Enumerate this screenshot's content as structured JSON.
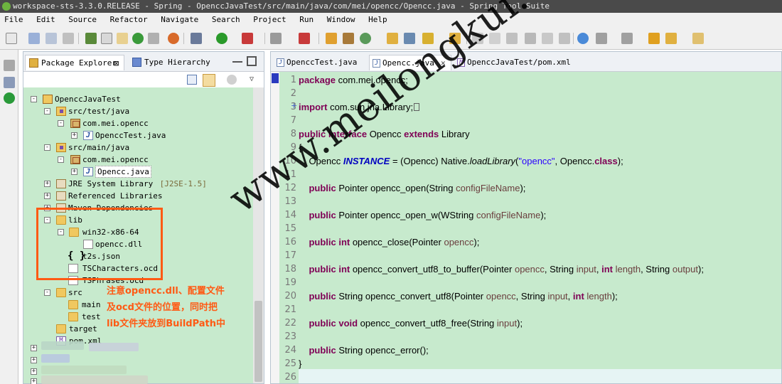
{
  "window": {
    "title": "workspace-sts-3.3.0.RELEASE - Spring - OpenccJavaTest/src/main/java/com/mei/opencc/Opencc.java - Spring Tool Suite"
  },
  "menubar": [
    "File",
    "Edit",
    "Source",
    "Refactor",
    "Navigate",
    "Search",
    "Project",
    "Run",
    "Window",
    "Help"
  ],
  "package_explorer": {
    "tabs": [
      {
        "label": "Package Explorer",
        "close": "⊠",
        "active": true
      },
      {
        "label": "Type Hierarchy",
        "active": false
      }
    ],
    "tree": [
      {
        "label": "OpenccJavaTest",
        "icon": "project-icon",
        "expander": "-"
      },
      {
        "label": "src/test/java",
        "icon": "source-folder-icon",
        "expander": "-"
      },
      {
        "label": "com.mei.opencc",
        "icon": "package-icon",
        "expander": "-"
      },
      {
        "label": "OpenccTest.java",
        "icon": "java-file-icon",
        "expander": "+"
      },
      {
        "label": "src/main/java",
        "icon": "source-folder-icon",
        "expander": "-"
      },
      {
        "label": "com.mei.opencc",
        "icon": "package-icon",
        "expander": "-"
      },
      {
        "label": "Opencc.java",
        "icon": "java-file-icon",
        "expander": "+",
        "selected": true
      },
      {
        "label": "JRE System Library",
        "suffix": "[J2SE-1.5]",
        "icon": "library-icon",
        "expander": "+"
      },
      {
        "label": "Referenced Libraries",
        "icon": "library-icon",
        "expander": "+"
      },
      {
        "label": "Maven Dependencies",
        "icon": "library-icon",
        "expander": "+"
      },
      {
        "label": "lib",
        "icon": "folder-icon",
        "expander": "-"
      },
      {
        "label": "win32-x86-64",
        "icon": "folder-icon",
        "expander": "-"
      },
      {
        "label": "opencc.dll",
        "icon": "file-icon"
      },
      {
        "label": "t2s.json",
        "icon": "json-file-icon"
      },
      {
        "label": "TSCharacters.ocd",
        "icon": "file-icon"
      },
      {
        "label": "TSPhrases.ocd",
        "icon": "file-icon"
      },
      {
        "label": "src",
        "icon": "folder-icon",
        "expander": "-"
      },
      {
        "label": "main",
        "icon": "folder-icon"
      },
      {
        "label": "test",
        "icon": "folder-icon"
      },
      {
        "label": "target",
        "icon": "folder-icon"
      },
      {
        "label": "pom.xml",
        "icon": "xml-file-icon",
        "icon_text": "M"
      }
    ],
    "annotation": [
      "注意opencc.dll、配置文件",
      "及ocd文件的位置，同时把",
      "lib文件夹放到BuildPath中"
    ]
  },
  "editor": {
    "tabs": [
      {
        "label": "OpenccTest.java",
        "active": false
      },
      {
        "label": "Opencc.java",
        "active": true,
        "close": "✕"
      },
      {
        "label": "OpenccJavaTest/pom.xml",
        "active": false
      }
    ],
    "lines": [
      {
        "num": "1",
        "code": [
          [
            "kw",
            "package"
          ],
          [
            "",
            " com.mei.opencc;"
          ]
        ]
      },
      {
        "num": "2",
        "code": []
      },
      {
        "num": "3",
        "fold": "+",
        "code": [
          [
            "kw",
            "import"
          ],
          [
            "",
            " com.sun.jna.Library;"
          ],
          [
            "box",
            ""
          ]
        ]
      },
      {
        "num": "7",
        "code": []
      },
      {
        "num": "8",
        "code": [
          [
            "kw",
            "public interface"
          ],
          [
            "",
            " Opencc "
          ],
          [
            "kw",
            "extends"
          ],
          [
            "",
            " Library"
          ]
        ]
      },
      {
        "num": "9",
        "code": [
          [
            "",
            "{"
          ]
        ]
      },
      {
        "num": "10",
        "code": [
          [
            "",
            "    Opencc "
          ],
          [
            "const",
            "INSTANCE"
          ],
          [
            "",
            " = (Opencc) Native."
          ],
          [
            "italic",
            "loadLibrary"
          ],
          [
            "",
            "("
          ],
          [
            "str",
            "\"opencc\""
          ],
          [
            "",
            ", Opencc."
          ],
          [
            "kw",
            "class"
          ],
          [
            "",
            ");"
          ]
        ]
      },
      {
        "num": "11",
        "code": []
      },
      {
        "num": "12",
        "code": [
          [
            "kw",
            "    public"
          ],
          [
            "",
            " Pointer opencc_open(String "
          ],
          [
            "param",
            "configFileName"
          ],
          [
            "",
            ");"
          ]
        ]
      },
      {
        "num": "13",
        "code": []
      },
      {
        "num": "14",
        "code": [
          [
            "kw",
            "    public"
          ],
          [
            "",
            " Pointer opencc_open_w(WString "
          ],
          [
            "param",
            "configFileName"
          ],
          [
            "",
            ");"
          ]
        ]
      },
      {
        "num": "15",
        "code": []
      },
      {
        "num": "16",
        "code": [
          [
            "kw",
            "    public int"
          ],
          [
            "",
            " opencc_close(Pointer "
          ],
          [
            "param",
            "opencc"
          ],
          [
            "",
            ");"
          ]
        ]
      },
      {
        "num": "17",
        "code": []
      },
      {
        "num": "18",
        "code": [
          [
            "kw",
            "    public int"
          ],
          [
            "",
            " opencc_convert_utf8_to_buffer(Pointer "
          ],
          [
            "param",
            "opencc"
          ],
          [
            "",
            ", String "
          ],
          [
            "param",
            "input"
          ],
          [
            "",
            ", "
          ],
          [
            "kw",
            "int"
          ],
          [
            "",
            " "
          ],
          [
            "param",
            "length"
          ],
          [
            "",
            ", String "
          ],
          [
            "param",
            "output"
          ],
          [
            "",
            ");"
          ]
        ]
      },
      {
        "num": "19",
        "code": []
      },
      {
        "num": "20",
        "code": [
          [
            "kw",
            "    public"
          ],
          [
            "",
            " String opencc_convert_utf8(Pointer "
          ],
          [
            "param",
            "opencc"
          ],
          [
            "",
            ", String "
          ],
          [
            "param",
            "input"
          ],
          [
            "",
            ", "
          ],
          [
            "kw",
            "int"
          ],
          [
            "",
            " "
          ],
          [
            "param",
            "length"
          ],
          [
            "",
            ");"
          ]
        ]
      },
      {
        "num": "21",
        "code": []
      },
      {
        "num": "22",
        "code": [
          [
            "kw",
            "    public void"
          ],
          [
            "",
            " opencc_convert_utf8_free(String "
          ],
          [
            "param",
            "input"
          ],
          [
            "",
            ");"
          ]
        ]
      },
      {
        "num": "23",
        "code": []
      },
      {
        "num": "24",
        "code": [
          [
            "kw",
            "    public"
          ],
          [
            "",
            " String opencc_error();"
          ]
        ]
      },
      {
        "num": "25",
        "code": [
          [
            "",
            "}"
          ]
        ]
      },
      {
        "num": "26",
        "code": []
      }
    ]
  },
  "watermark": "www.meilongkui.com",
  "colors": {
    "editor_bg": "#c7eacd",
    "annotation": "#ff5a14",
    "keyword": "#7f0055",
    "string": "#2a00ff",
    "constant": "#0000c0",
    "parameter": "#6a3e3e"
  }
}
